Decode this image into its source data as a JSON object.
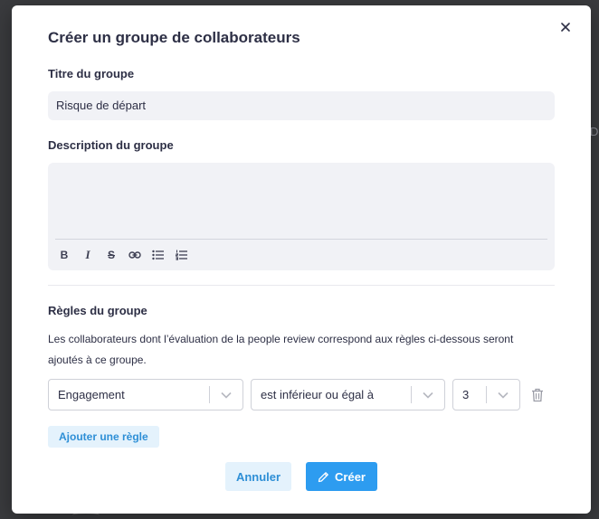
{
  "modal": {
    "title": "Créer un groupe de collaborateurs",
    "close_icon": "close-icon"
  },
  "group_title": {
    "label": "Titre du groupe",
    "value": "Risque de départ"
  },
  "description": {
    "label": "Description du groupe",
    "value": "",
    "toolbar": [
      "bold-icon",
      "italic-icon",
      "strikethrough-icon",
      "link-icon",
      "bullet-list-icon",
      "numbered-list-icon"
    ]
  },
  "rules": {
    "label": "Règles du groupe",
    "help_line1": "Les collaborateurs dont l’évaluation de la people review correspond aux règles ci-dessous seront",
    "help_line2": "ajoutés à ce groupe.",
    "rule": {
      "criterion": "Engagement",
      "operator": "est inférieur ou égal à",
      "value": "3"
    },
    "add_rule_label": "Ajouter une règle"
  },
  "footer": {
    "cancel_label": "Annuler",
    "create_label": "Créer"
  }
}
